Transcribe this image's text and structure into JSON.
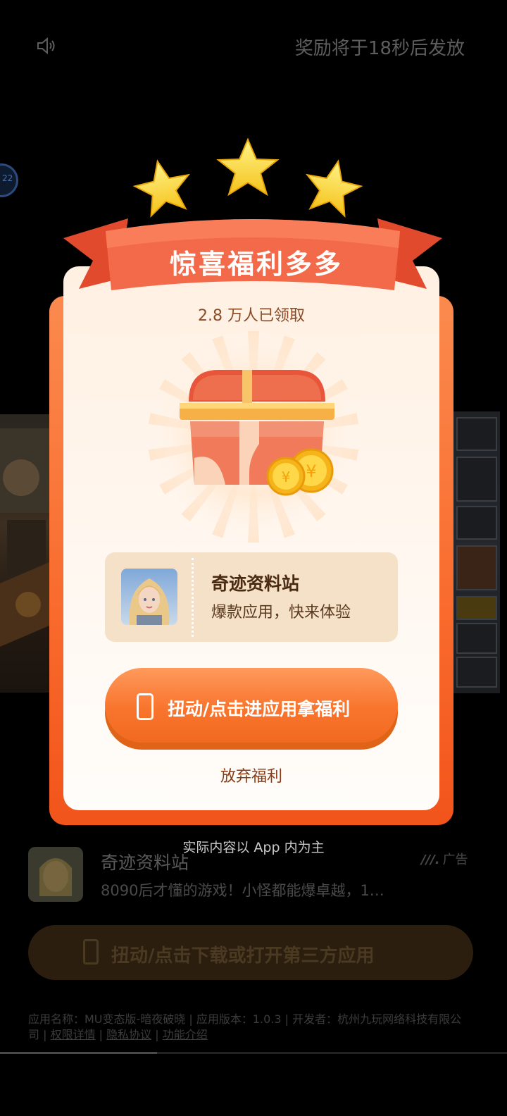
{
  "top_bar": {
    "countdown": "奖励将于18秒后发放",
    "speaker_icon": "speaker-icon"
  },
  "reward_card": {
    "ribbon_title": "惊喜福利多多",
    "claimed_count": "2.8 万人已领取",
    "app_name": "奇迹资料站",
    "app_slogan": "爆款应用，快来体验",
    "cta_label": "扭动/点击进应用拿福利",
    "give_up": "放弃福利",
    "footnote": "实际内容以 App 内为主"
  },
  "background_ad": {
    "app_title": "奇迹资料站",
    "description": "8090后才懂的游戏！小怪都能爆卓越，1…",
    "ad_tag": "广告",
    "download_button": "扭动/点击下载或打开第三方应用",
    "info_line": "应用名称：MU变态版-暗夜破晓 | 应用版本：1.0.3 | 开发者：杭州九玩网络科技有限公司 | ",
    "link_permissions": "权限详情",
    "link_privacy": "隐私协议",
    "link_features": "功能介绍",
    "separator": " | ",
    "edge_badge": "22"
  },
  "video_progress": 0.31,
  "colors": {
    "card_orange": "#f96a2d",
    "ribbon_red": "#f26045",
    "cta_orange": "#f8742c",
    "panel_beige": "#f5e1c8"
  }
}
